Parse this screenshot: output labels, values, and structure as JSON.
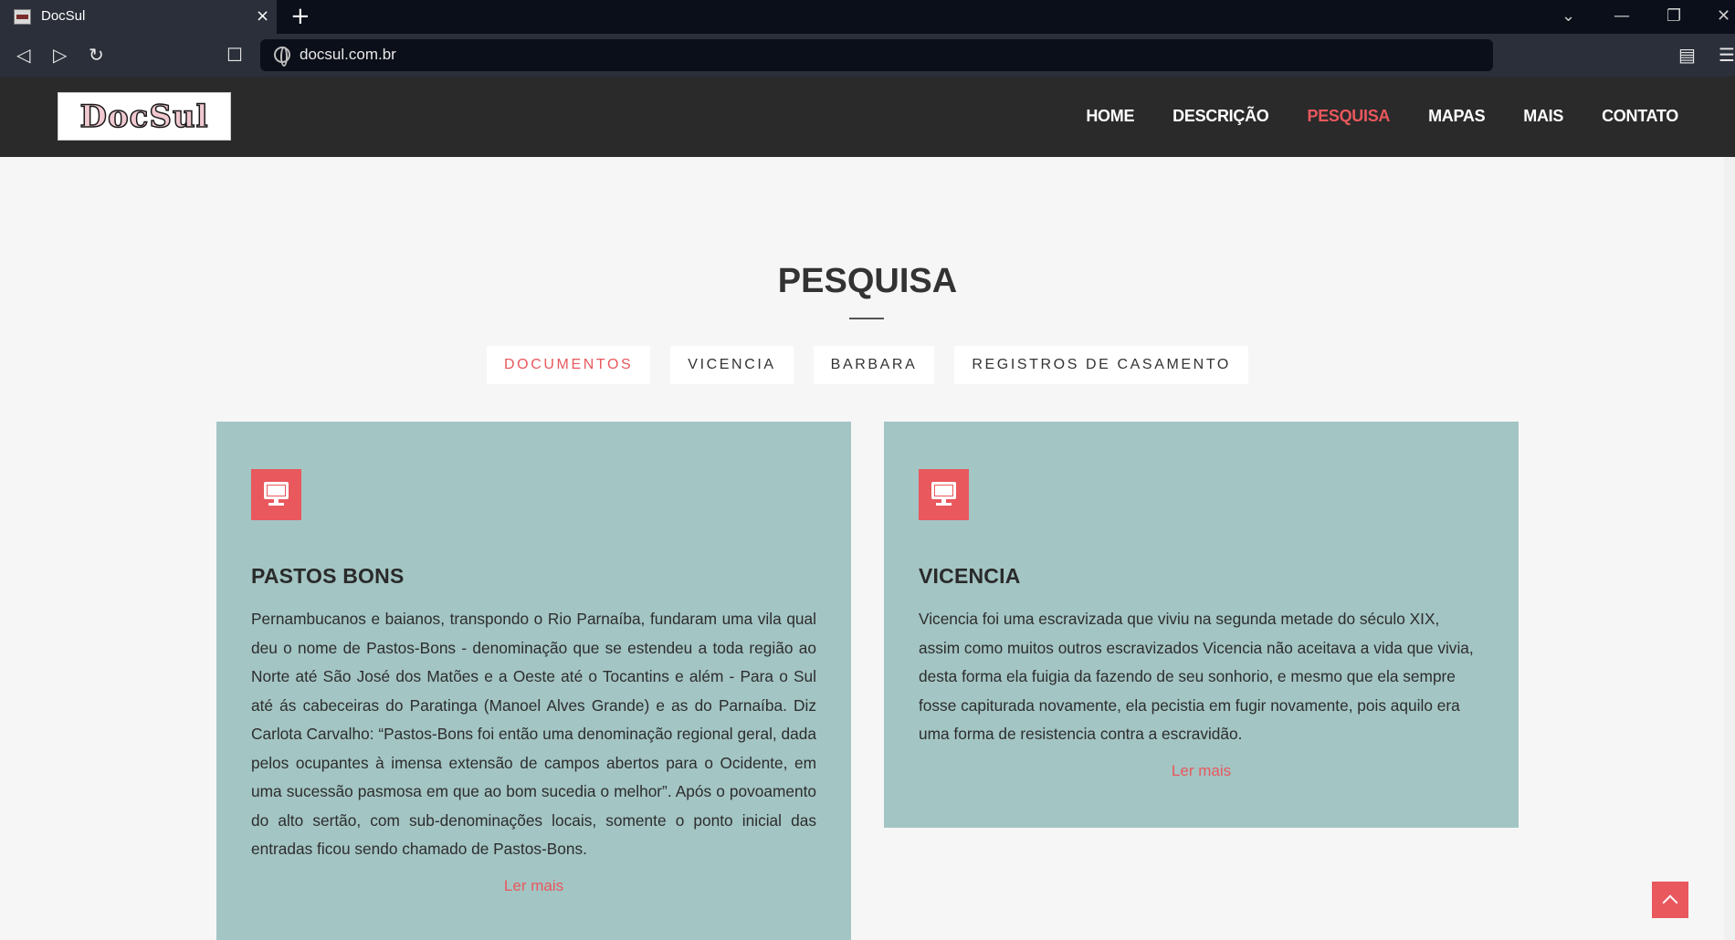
{
  "browser": {
    "tab_title": "DocSul",
    "tab_close": "×",
    "new_tab": "+",
    "url": "docsul.com.br"
  },
  "site": {
    "logo_text": "DocSul",
    "nav": [
      {
        "label": "HOME"
      },
      {
        "label": "DESCRIÇÃO"
      },
      {
        "label": "PESQUISA"
      },
      {
        "label": "MAPAS"
      },
      {
        "label": "MAIS"
      },
      {
        "label": "CONTATO"
      }
    ],
    "active_nav": "PESQUISA"
  },
  "section": {
    "title": "PESQUISA",
    "filters": [
      {
        "label": "DOCUMENTOS"
      },
      {
        "label": "VICENCIA"
      },
      {
        "label": "BARBARA"
      },
      {
        "label": "REGISTROS DE CASAMENTO"
      }
    ],
    "active_filter": "DOCUMENTOS"
  },
  "cards": [
    {
      "icon": "desktop-icon",
      "title": "PASTOS BONS",
      "text": "Pernambucanos e baianos, transpondo o Rio Parnaíba, fundaram uma vila qual deu o nome de Pastos-Bons - denominação que se estendeu a toda região ao Norte até São José dos Matões e a Oeste até o Tocantins e além - Para o Sul até ás cabeceiras do Paratinga (Manoel Alves Grande) e as do Parnaíba. Diz Carlota Carvalho: “Pastos-Bons foi então uma denominação regional geral, dada pelos ocupantes à imensa extensão de campos abertos para o Ocidente, em uma sucessão pasmosa em que ao bom sucedia o melhor”. Após o povoamento do alto sertão, com sub-denominações locais, somente o ponto inicial das entradas ficou sendo chamado de Pastos-Bons.",
      "read_more": "Ler mais"
    },
    {
      "icon": "desktop-icon",
      "title": "VICENCIA",
      "text": "Vicencia foi uma escravizada que viviu na segunda metade do século XIX, assim como muitos outros escravizados Vicencia não aceitava a vida que vivia, desta forma ela fuigia da fazendo de seu sonhorio, e mesmo que ela sempre fosse capiturada novamente, ela pecistia em fugir novamente, pois aquilo era uma forma de resistencia contra a escravidão.",
      "read_more": "Ler mais"
    }
  ],
  "colors": {
    "accent": "#e8585d",
    "card_bg": "#a3c5c4",
    "header_bg": "#2a2a2a",
    "page_bg": "#f6f6f6"
  }
}
